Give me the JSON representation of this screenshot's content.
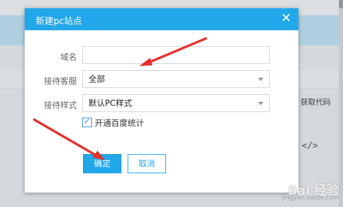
{
  "background": {
    "column_header": "获取代码",
    "code_icon": "</>"
  },
  "dialog": {
    "title": "新建pc站点",
    "close_icon": "close-icon",
    "fields": {
      "domain": {
        "label": "域名",
        "value": ""
      },
      "service": {
        "label": "接待客服",
        "value": "全部"
      },
      "style": {
        "label": "接待样式",
        "value": "默认PC样式"
      }
    },
    "checkbox": {
      "label": "开通百度统计",
      "checked": true
    },
    "buttons": {
      "confirm": "确定",
      "cancel": "取消"
    }
  },
  "watermark": {
    "main": "Bai 经验",
    "sub": "jingyan.baidu.com"
  },
  "colors": {
    "accent": "#22a7ea",
    "arrow": "#e0322e"
  }
}
